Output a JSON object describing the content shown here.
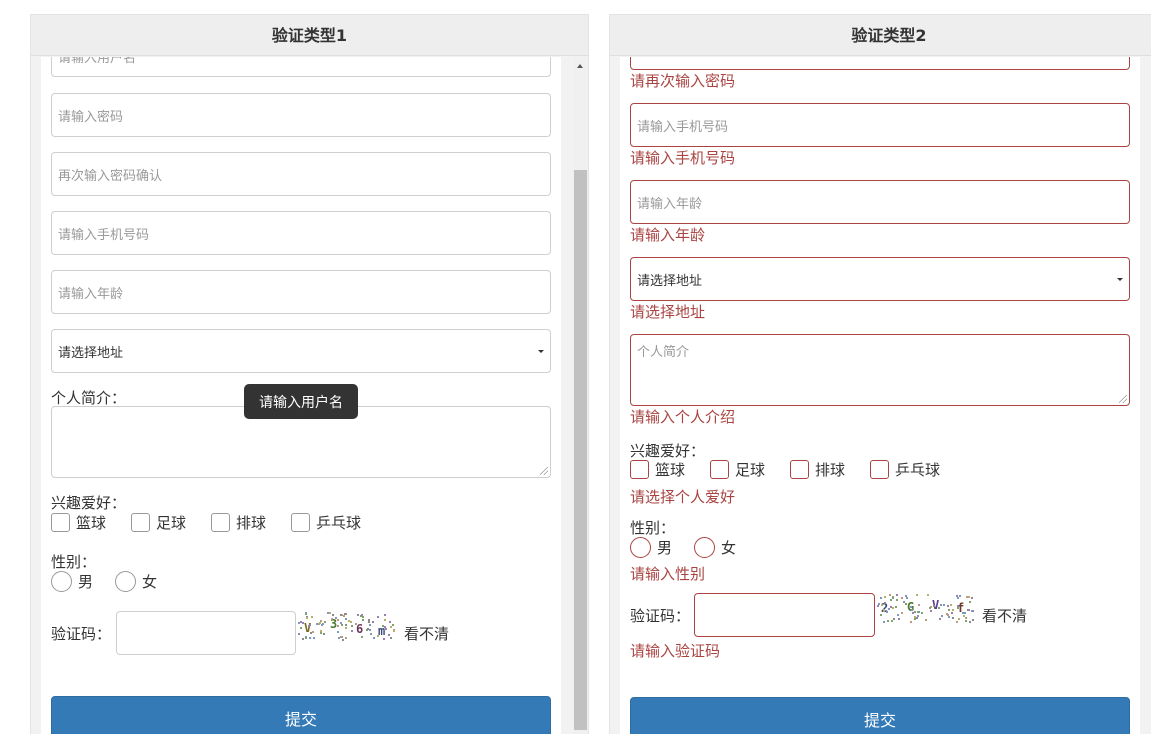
{
  "left": {
    "title": "验证类型1",
    "username_placeholder": "请输入用户名",
    "password_placeholder": "请输入密码",
    "confirm_placeholder": "再次输入密码确认",
    "phone_placeholder": "请输入手机号码",
    "age_placeholder": "请输入年龄",
    "address_value": "请选择地址",
    "intro_label": "个人简介：",
    "hobby_label": "兴趣爱好：",
    "hobbies": [
      "篮球",
      "足球",
      "排球",
      "乒乓球"
    ],
    "gender_label": "性别：",
    "genders": [
      "男",
      "女"
    ],
    "captcha_label": "验证码：",
    "captcha_chars": [
      "V",
      "3",
      "6",
      "m"
    ],
    "captcha_refresh": "看不清",
    "submit_label": "提交",
    "tooltip": "请输入用户名"
  },
  "right": {
    "title": "验证类型2",
    "confirm_error": "请再次输入密码",
    "phone_placeholder": "请输入手机号码",
    "phone_error": "请输入手机号码",
    "age_placeholder": "请输入年龄",
    "age_error": "请输入年龄",
    "address_value": "请选择地址",
    "address_error": "请选择地址",
    "intro_placeholder": "个人简介",
    "intro_error": "请输入个人介绍",
    "hobby_label": "兴趣爱好：",
    "hobbies": [
      "篮球",
      "足球",
      "排球",
      "乒乓球"
    ],
    "hobby_error": "请选择个人爱好",
    "gender_label": "性别：",
    "genders": [
      "男",
      "女"
    ],
    "gender_error": "请输入性别",
    "captcha_label": "验证码：",
    "captcha_chars": [
      "2",
      "G",
      "V",
      "f"
    ],
    "captcha_refresh": "看不清",
    "captcha_error": "请输入验证码",
    "submit_label": "提交"
  },
  "colors": {
    "primary": "#337ab7",
    "error": "#a94442",
    "tooltip_bg": "#333333",
    "panel_bg": "#f2f2f2"
  }
}
